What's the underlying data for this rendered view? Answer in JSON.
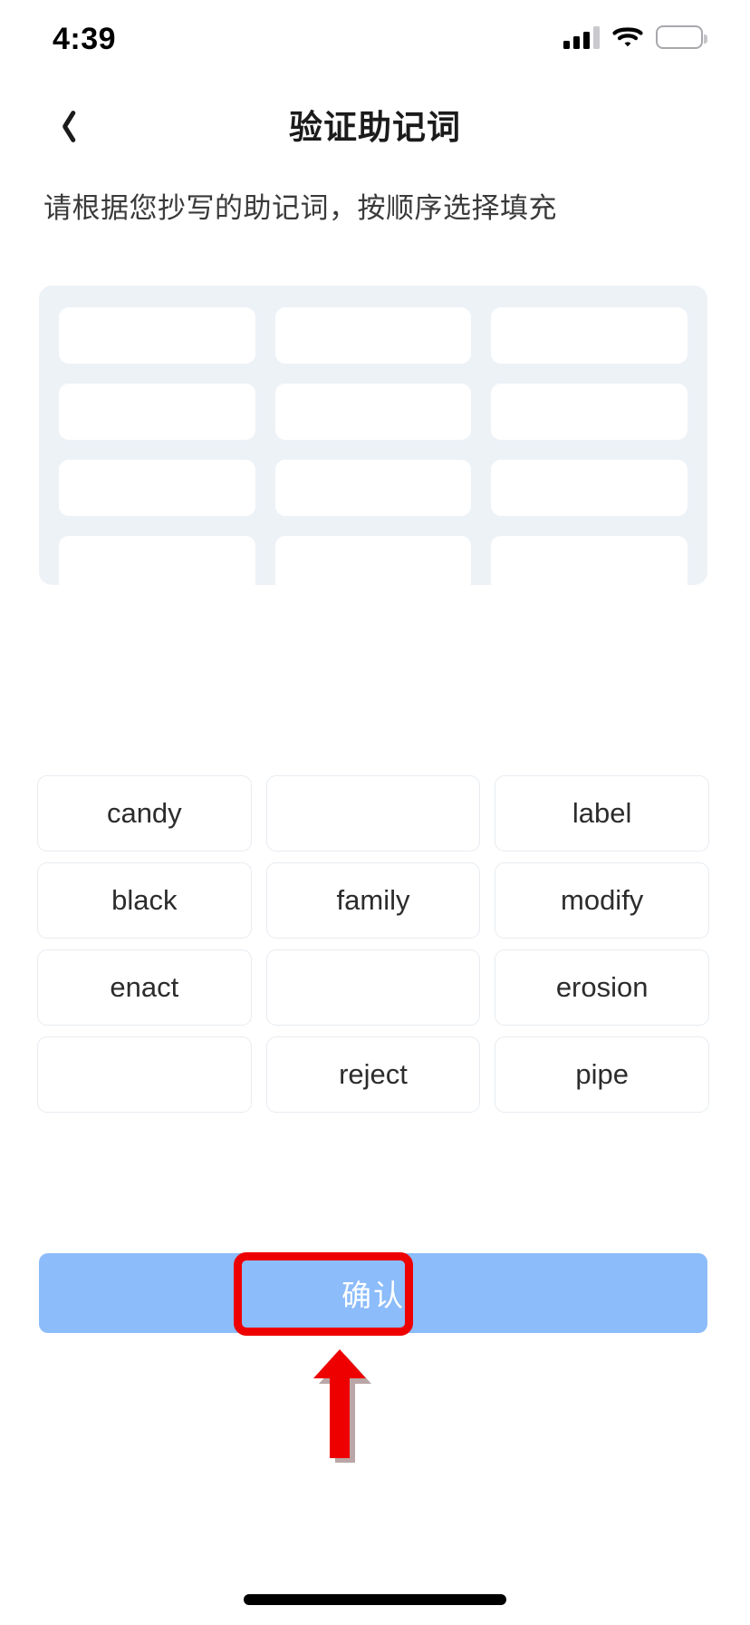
{
  "status_bar": {
    "time": "4:39",
    "signal_icon": "cellular-signal-icon",
    "signal_bars_filled": 3,
    "signal_bars_total": 4,
    "wifi_icon": "wifi-icon",
    "battery_icon": "battery-icon",
    "battery_level_percent": 60,
    "battery_color": "#fccc0a"
  },
  "nav": {
    "back_icon": "chevron-left-icon",
    "title": "验证助记词"
  },
  "instruction": "请根据您抄写的助记词，按顺序选择填充",
  "answer_grid": {
    "columns": 3,
    "rows": 4,
    "background_color": "#edf2f7",
    "slot_color": "#ffffff",
    "slots": [
      "",
      "",
      "",
      "",
      "",
      "",
      "",
      "",
      "",
      "",
      "",
      ""
    ]
  },
  "word_bank": {
    "columns": 3,
    "rows": 4,
    "words": [
      "candy",
      "",
      "label",
      "black",
      "family",
      "modify",
      "enact",
      "",
      "erosion",
      "",
      "reject",
      "pipe"
    ]
  },
  "confirm": {
    "label": "确认",
    "background_color": "#8cbcfa",
    "text_color": "#ffffff"
  },
  "annotations": {
    "highlight_color": "#ee0000",
    "highlight_target": "confirm-button",
    "arrow_icon": "up-arrow-annotation",
    "arrow_direction": "up"
  },
  "home_indicator": "home-indicator-bar"
}
